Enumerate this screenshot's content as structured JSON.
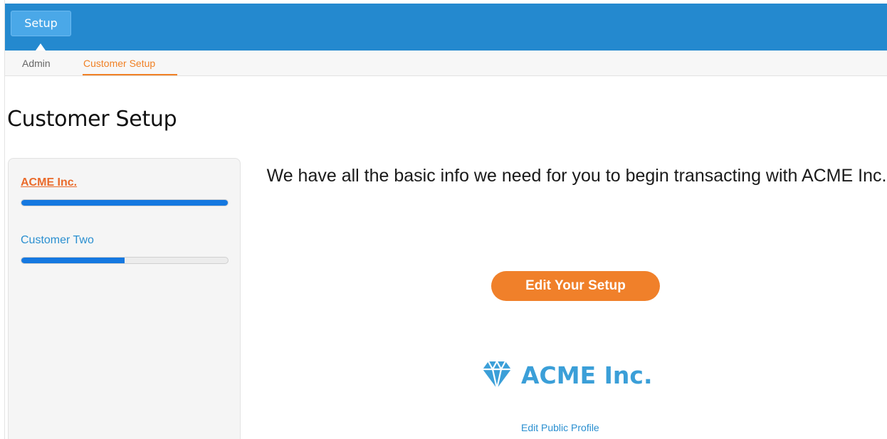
{
  "topbar": {
    "tab_label": "Setup",
    "color": "#2489cf"
  },
  "subnav": {
    "items": [
      {
        "label": "Admin",
        "active": false
      },
      {
        "label": "Customer Setup",
        "active": true
      }
    ],
    "active_color": "#f08024"
  },
  "page": {
    "title": "Customer Setup"
  },
  "sidebar": {
    "customers": [
      {
        "name": "ACME Inc.",
        "selected": true,
        "progress_percent": 100
      },
      {
        "name": "Customer Two",
        "selected": false,
        "progress_percent": 50
      }
    ],
    "progress_color": "#1578e0"
  },
  "main": {
    "message": "We have all the basic info we need for you to begin transacting with ACME Inc.",
    "edit_button_label": "Edit Your Setup",
    "brand": {
      "icon": "diamond-icon",
      "name": "ACME Inc.",
      "color": "#3b9fd8"
    },
    "edit_profile_label": "Edit Public Profile"
  }
}
